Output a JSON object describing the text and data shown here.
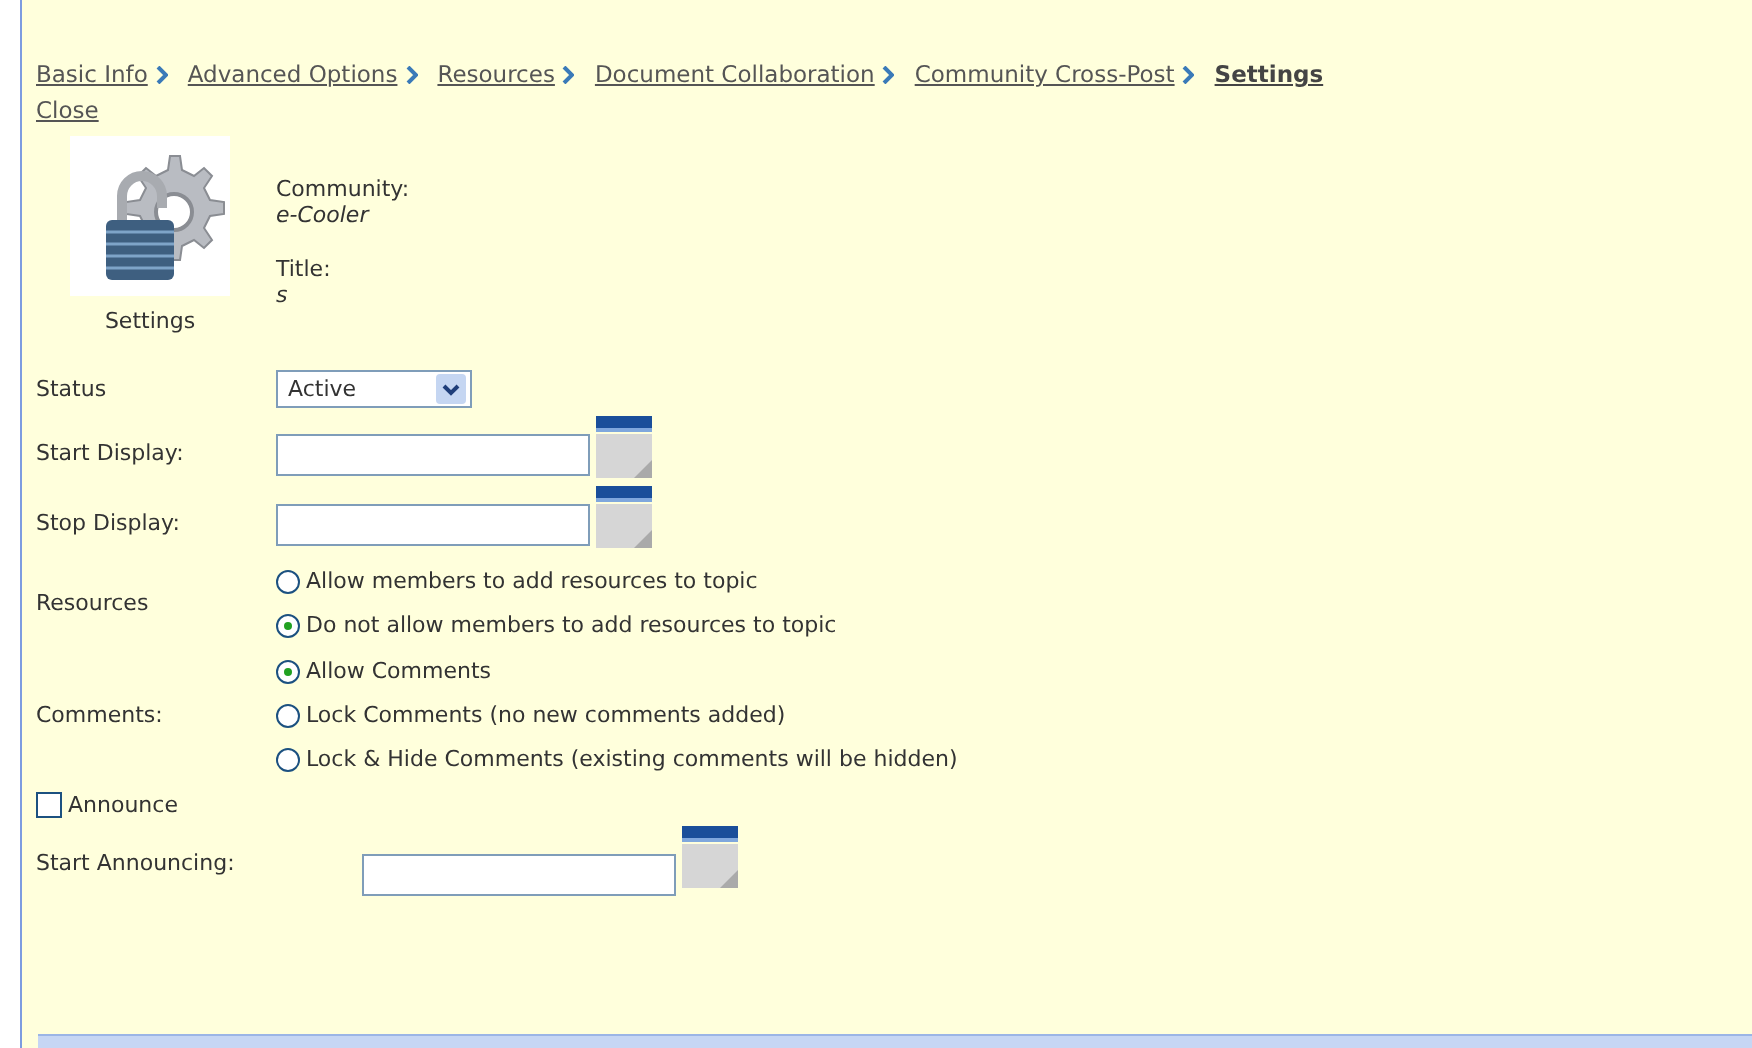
{
  "breadcrumbs": [
    {
      "label": "Basic Info",
      "current": false
    },
    {
      "label": "Advanced Options",
      "current": false
    },
    {
      "label": "Resources",
      "current": false
    },
    {
      "label": "Document Collaboration",
      "current": false
    },
    {
      "label": "Community Cross-Post",
      "current": false
    },
    {
      "label": "Settings",
      "current": true
    }
  ],
  "close": "Close",
  "header": {
    "icon_caption": "Settings",
    "community_label": "Community:",
    "community": "e-Cooler",
    "title_label": "Title:",
    "title": "s"
  },
  "fields": [
    {
      "kind": "select",
      "label": "Status",
      "value": "Active"
    },
    {
      "kind": "date",
      "label": "Start Display:"
    },
    {
      "kind": "date",
      "label": "Stop Display:"
    },
    {
      "kind": "radio",
      "label": "Resources",
      "options": [
        {
          "label": "Allow members to add resources to topic",
          "selected": false
        },
        {
          "label": "Do not allow members to add resources to topic",
          "selected": true
        }
      ]
    },
    {
      "kind": "radio",
      "label": "Comments:",
      "options": [
        {
          "label": "Allow Comments",
          "selected": true
        },
        {
          "label": "Lock Comments (no new comments added)",
          "selected": false
        },
        {
          "label": "Lock & Hide Comments (existing comments will be hidden)",
          "selected": false
        }
      ]
    },
    {
      "kind": "checkbox",
      "label": "Announce",
      "checked": false
    },
    {
      "kind": "date-wide",
      "label": "Start Announcing:"
    }
  ]
}
